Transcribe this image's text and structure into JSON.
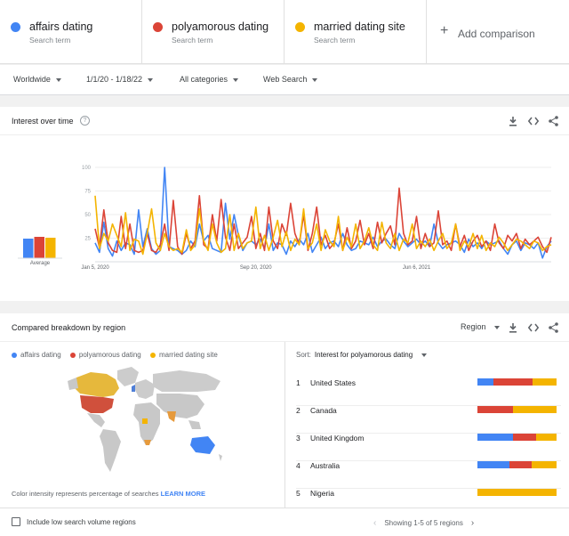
{
  "search_terms": [
    {
      "name": "affairs dating",
      "sub": "Search term",
      "color": "#4285f4"
    },
    {
      "name": "polyamorous dating",
      "sub": "Search term",
      "color": "#db4437"
    },
    {
      "name": "married dating site",
      "sub": "Search term",
      "color": "#f4b400"
    }
  ],
  "add_comparison": "Add comparison",
  "filters": {
    "region": "Worldwide",
    "time": "1/1/20 - 1/18/22",
    "category": "All categories",
    "source": "Web Search"
  },
  "interest": {
    "title": "Interest over time",
    "average_label": "Average"
  },
  "chart_data": {
    "type": "line",
    "title": "",
    "ylim": [
      0,
      100
    ],
    "yticks": [
      25,
      50,
      75,
      100
    ],
    "xtick_labels": [
      "Jan 5, 2020",
      "Sep 20, 2020",
      "Jun 6, 2021"
    ],
    "xtick_index": [
      0,
      37,
      74
    ],
    "grid": true,
    "averages": [
      22,
      24,
      23
    ],
    "series": [
      {
        "name": "affairs dating",
        "color": "#4285f4",
        "values": [
          20,
          10,
          42,
          14,
          6,
          22,
          12,
          20,
          18,
          8,
          55,
          16,
          35,
          14,
          8,
          12,
          100,
          16,
          14,
          12,
          8,
          12,
          22,
          16,
          40,
          22,
          28,
          14,
          12,
          10,
          62,
          24,
          50,
          28,
          12,
          20,
          22,
          18,
          24,
          14,
          40,
          12,
          20,
          18,
          8,
          22,
          16,
          24,
          18,
          30,
          10,
          18,
          26,
          14,
          20,
          22,
          16,
          30,
          18,
          12,
          14,
          22,
          20,
          18,
          26,
          16,
          22,
          24,
          18,
          14,
          30,
          22,
          16,
          20,
          24,
          18,
          22,
          16,
          40,
          20,
          14,
          18,
          20,
          22,
          18,
          10,
          24,
          16,
          20,
          14,
          22,
          18,
          20,
          22,
          14,
          8,
          18,
          22,
          12,
          20,
          18,
          14,
          20,
          4,
          16,
          22
        ]
      },
      {
        "name": "polyamorous dating",
        "color": "#db4437",
        "values": [
          35,
          15,
          55,
          20,
          12,
          10,
          48,
          14,
          40,
          12,
          10,
          12,
          30,
          12,
          10,
          18,
          40,
          12,
          65,
          16,
          8,
          30,
          14,
          22,
          70,
          18,
          14,
          50,
          22,
          66,
          26,
          12,
          40,
          14,
          20,
          26,
          48,
          14,
          30,
          12,
          58,
          22,
          14,
          40,
          28,
          62,
          30,
          18,
          50,
          12,
          30,
          58,
          18,
          28,
          14,
          20,
          40,
          12,
          36,
          14,
          22,
          44,
          18,
          30,
          14,
          42,
          20,
          30,
          38,
          18,
          78,
          30,
          18,
          22,
          48,
          14,
          30,
          16,
          20,
          54,
          18,
          22,
          12,
          40,
          16,
          28,
          12,
          22,
          28,
          16,
          22,
          12,
          40,
          20,
          14,
          28,
          22,
          30,
          14,
          24,
          18,
          22,
          26,
          16,
          10,
          26
        ]
      },
      {
        "name": "married dating site",
        "color": "#f4b400",
        "values": [
          70,
          14,
          30,
          22,
          40,
          28,
          16,
          52,
          12,
          24,
          22,
          8,
          30,
          56,
          20,
          12,
          30,
          16,
          12,
          14,
          10,
          34,
          12,
          18,
          56,
          22,
          12,
          40,
          20,
          10,
          14,
          50,
          12,
          30,
          14,
          20,
          22,
          58,
          14,
          28,
          12,
          26,
          44,
          16,
          32,
          12,
          24,
          18,
          56,
          14,
          20,
          40,
          12,
          34,
          22,
          16,
          48,
          12,
          26,
          16,
          40,
          14,
          22,
          36,
          18,
          12,
          42,
          20,
          14,
          30,
          12,
          24,
          20,
          40,
          14,
          22,
          16,
          24,
          12,
          22,
          30,
          14,
          20,
          40,
          12,
          22,
          16,
          30,
          14,
          28,
          12,
          20,
          16,
          26,
          20,
          12,
          18,
          24,
          22,
          18,
          14,
          22,
          20,
          12,
          16,
          18
        ]
      }
    ]
  },
  "breakdown": {
    "title": "Compared breakdown by region",
    "region_label": "Region",
    "legend": [
      "affairs dating",
      "polyamorous dating",
      "married dating site"
    ],
    "note": "Color intensity represents percentage of searches",
    "learn_more": "LEARN MORE",
    "sort_label": "Sort:",
    "sort_value": "Interest for polyamorous dating",
    "rows": [
      {
        "rank": "1",
        "name": "United States",
        "shares": [
          0.2,
          0.5,
          0.3
        ]
      },
      {
        "rank": "2",
        "name": "Canada",
        "shares": [
          0.0,
          0.45,
          0.55
        ]
      },
      {
        "rank": "3",
        "name": "United Kingdom",
        "shares": [
          0.45,
          0.29,
          0.26
        ]
      },
      {
        "rank": "4",
        "name": "Australia",
        "shares": [
          0.4,
          0.28,
          0.32
        ]
      },
      {
        "rank": "5",
        "name": "Nigeria",
        "shares": [
          0.0,
          0.0,
          1.0
        ]
      }
    ],
    "include_low": "Include low search volume regions",
    "pager": "Showing 1-5 of 5 regions"
  }
}
